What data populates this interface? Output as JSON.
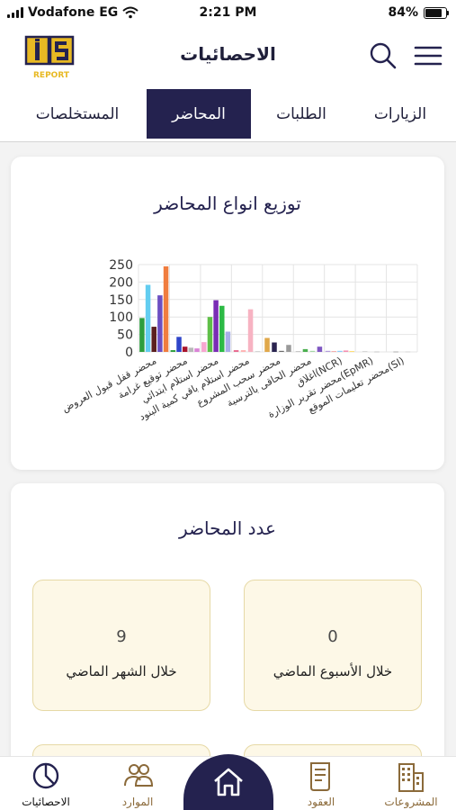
{
  "status_bar": {
    "carrier": "Vodafone EG",
    "time": "2:21 PM",
    "battery": "84%"
  },
  "header": {
    "title": "الاحصائيات",
    "logo_text": "REPORT",
    "logo_letters": "iS"
  },
  "tabs": [
    {
      "label": "الزيارات",
      "active": false
    },
    {
      "label": "الطلبات",
      "active": false
    },
    {
      "label": "المحاضر",
      "active": true
    },
    {
      "label": "المستخلصات",
      "active": false
    }
  ],
  "chart_card": {
    "title": "توزيع انواع المحاضر",
    "chart_data": {
      "type": "bar",
      "title": "توزيع انواع المحاضر",
      "ylim": [
        0,
        250
      ],
      "yticks": [
        "0",
        "50",
        "100",
        "150",
        "200",
        "250"
      ],
      "grid": true,
      "categories": [
        "محضر قفل قبول العروض",
        "محضر توقيع غرامة",
        "محضر استلام ابتدائي",
        "محضر استلام باقي كمية البنود",
        "محضر سحب المشروع",
        "محضر الحاقى بالترسية",
        "اغلاق(NCR)",
        "محضر تقرير الوزارة(EpMR)",
        "محضر تعليمات الموقع(SI)"
      ],
      "bars": [
        {
          "category_index": 0,
          "value": 97,
          "color": "#2e9e3e"
        },
        {
          "category_index": 0,
          "value": 192,
          "color": "#62cdf0"
        },
        {
          "category_index": 0,
          "value": 72,
          "color": "#5b1f1f"
        },
        {
          "category_index": 0,
          "value": 162,
          "color": "#6c4fc2"
        },
        {
          "category_index": 0,
          "value": 245,
          "color": "#f07d3f"
        },
        {
          "category_index": 1,
          "value": 5,
          "color": "#2e9e3e"
        },
        {
          "category_index": 1,
          "value": 43,
          "color": "#2f45c9"
        },
        {
          "category_index": 1,
          "value": 15,
          "color": "#a8142d"
        },
        {
          "category_index": 1,
          "value": 12,
          "color": "#b8b8b8"
        },
        {
          "category_index": 1,
          "value": 10,
          "color": "#d983d6"
        },
        {
          "category_index": 2,
          "value": 28,
          "color": "#f7a6d0"
        },
        {
          "category_index": 2,
          "value": 100,
          "color": "#5fbf48"
        },
        {
          "category_index": 2,
          "value": 148,
          "color": "#7a2db5"
        },
        {
          "category_index": 2,
          "value": 132,
          "color": "#2cba45"
        },
        {
          "category_index": 2,
          "value": 58,
          "color": "#a8aee8"
        },
        {
          "category_index": 3,
          "value": 5,
          "color": "#e86a8f"
        },
        {
          "category_index": 3,
          "value": 5,
          "color": "#ffb3b3"
        },
        {
          "category_index": 3,
          "value": 122,
          "color": "#f7b3c2"
        },
        {
          "category_index": 3,
          "value": 2,
          "color": "#c7c7c7"
        },
        {
          "category_index": 4,
          "value": 40,
          "color": "#e0a84a"
        },
        {
          "category_index": 4,
          "value": 27,
          "color": "#2a2450"
        },
        {
          "category_index": 4,
          "value": 3,
          "color": "#6b6b6b"
        },
        {
          "category_index": 4,
          "value": 20,
          "color": "#9a9a9a"
        },
        {
          "category_index": 5,
          "value": 2,
          "color": "#b8b8b8"
        },
        {
          "category_index": 5,
          "value": 8,
          "color": "#4caf50"
        },
        {
          "category_index": 5,
          "value": 3,
          "color": "#a5d6a7"
        },
        {
          "category_index": 5,
          "value": 15,
          "color": "#7e57c2"
        },
        {
          "category_index": 6,
          "value": 3,
          "color": "#b39ddb"
        },
        {
          "category_index": 6,
          "value": 2,
          "color": "#ef9a9a"
        },
        {
          "category_index": 6,
          "value": 3,
          "color": "#90caf9"
        },
        {
          "category_index": 6,
          "value": 4,
          "color": "#f48fb1"
        },
        {
          "category_index": 6,
          "value": 2,
          "color": "#ffd54f"
        },
        {
          "category_index": 7,
          "value": 2,
          "color": "#cccccc"
        },
        {
          "category_index": 7,
          "value": 1,
          "color": "#bdbdbd"
        },
        {
          "category_index": 8,
          "value": 1,
          "color": "#9e9e9e"
        },
        {
          "category_index": 8,
          "value": 1,
          "color": "#cfcfcf"
        }
      ]
    }
  },
  "count_card": {
    "title": "عدد المحاضر",
    "stats": [
      {
        "value": "0",
        "label": "خلال الأسبوع الماضي"
      },
      {
        "value": "9",
        "label": "خلال الشهر الماضي"
      }
    ]
  },
  "bottom_nav": {
    "items": [
      {
        "label": "المشروعات",
        "icon": "buildings-icon"
      },
      {
        "label": "العقود",
        "icon": "document-icon"
      },
      {
        "label": "الموارد",
        "icon": "people-icon"
      },
      {
        "label": "الاحصائيات",
        "icon": "pie-chart-icon",
        "active": true
      }
    ],
    "home_icon": "home-icon"
  },
  "colors": {
    "primary": "#24224f",
    "gold": "#e8b923",
    "stat_bg": "#fdf8e7"
  }
}
